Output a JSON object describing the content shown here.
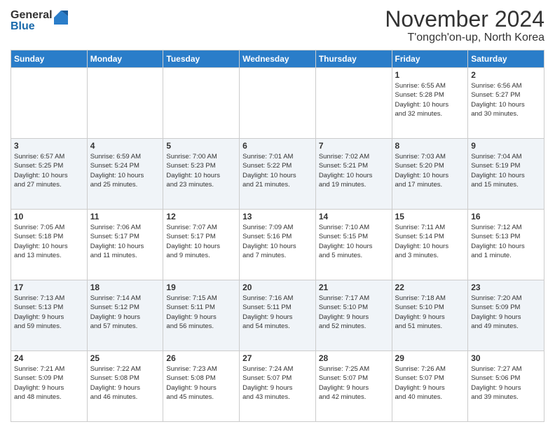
{
  "logo": {
    "general": "General",
    "blue": "Blue"
  },
  "header": {
    "month": "November 2024",
    "location": "T'ongch'on-up, North Korea"
  },
  "days_of_week": [
    "Sunday",
    "Monday",
    "Tuesday",
    "Wednesday",
    "Thursday",
    "Friday",
    "Saturday"
  ],
  "weeks": [
    [
      {
        "day": "",
        "info": ""
      },
      {
        "day": "",
        "info": ""
      },
      {
        "day": "",
        "info": ""
      },
      {
        "day": "",
        "info": ""
      },
      {
        "day": "",
        "info": ""
      },
      {
        "day": "1",
        "info": "Sunrise: 6:55 AM\nSunset: 5:28 PM\nDaylight: 10 hours\nand 32 minutes."
      },
      {
        "day": "2",
        "info": "Sunrise: 6:56 AM\nSunset: 5:27 PM\nDaylight: 10 hours\nand 30 minutes."
      }
    ],
    [
      {
        "day": "3",
        "info": "Sunrise: 6:57 AM\nSunset: 5:25 PM\nDaylight: 10 hours\nand 27 minutes."
      },
      {
        "day": "4",
        "info": "Sunrise: 6:59 AM\nSunset: 5:24 PM\nDaylight: 10 hours\nand 25 minutes."
      },
      {
        "day": "5",
        "info": "Sunrise: 7:00 AM\nSunset: 5:23 PM\nDaylight: 10 hours\nand 23 minutes."
      },
      {
        "day": "6",
        "info": "Sunrise: 7:01 AM\nSunset: 5:22 PM\nDaylight: 10 hours\nand 21 minutes."
      },
      {
        "day": "7",
        "info": "Sunrise: 7:02 AM\nSunset: 5:21 PM\nDaylight: 10 hours\nand 19 minutes."
      },
      {
        "day": "8",
        "info": "Sunrise: 7:03 AM\nSunset: 5:20 PM\nDaylight: 10 hours\nand 17 minutes."
      },
      {
        "day": "9",
        "info": "Sunrise: 7:04 AM\nSunset: 5:19 PM\nDaylight: 10 hours\nand 15 minutes."
      }
    ],
    [
      {
        "day": "10",
        "info": "Sunrise: 7:05 AM\nSunset: 5:18 PM\nDaylight: 10 hours\nand 13 minutes."
      },
      {
        "day": "11",
        "info": "Sunrise: 7:06 AM\nSunset: 5:17 PM\nDaylight: 10 hours\nand 11 minutes."
      },
      {
        "day": "12",
        "info": "Sunrise: 7:07 AM\nSunset: 5:17 PM\nDaylight: 10 hours\nand 9 minutes."
      },
      {
        "day": "13",
        "info": "Sunrise: 7:09 AM\nSunset: 5:16 PM\nDaylight: 10 hours\nand 7 minutes."
      },
      {
        "day": "14",
        "info": "Sunrise: 7:10 AM\nSunset: 5:15 PM\nDaylight: 10 hours\nand 5 minutes."
      },
      {
        "day": "15",
        "info": "Sunrise: 7:11 AM\nSunset: 5:14 PM\nDaylight: 10 hours\nand 3 minutes."
      },
      {
        "day": "16",
        "info": "Sunrise: 7:12 AM\nSunset: 5:13 PM\nDaylight: 10 hours\nand 1 minute."
      }
    ],
    [
      {
        "day": "17",
        "info": "Sunrise: 7:13 AM\nSunset: 5:13 PM\nDaylight: 9 hours\nand 59 minutes."
      },
      {
        "day": "18",
        "info": "Sunrise: 7:14 AM\nSunset: 5:12 PM\nDaylight: 9 hours\nand 57 minutes."
      },
      {
        "day": "19",
        "info": "Sunrise: 7:15 AM\nSunset: 5:11 PM\nDaylight: 9 hours\nand 56 minutes."
      },
      {
        "day": "20",
        "info": "Sunrise: 7:16 AM\nSunset: 5:11 PM\nDaylight: 9 hours\nand 54 minutes."
      },
      {
        "day": "21",
        "info": "Sunrise: 7:17 AM\nSunset: 5:10 PM\nDaylight: 9 hours\nand 52 minutes."
      },
      {
        "day": "22",
        "info": "Sunrise: 7:18 AM\nSunset: 5:10 PM\nDaylight: 9 hours\nand 51 minutes."
      },
      {
        "day": "23",
        "info": "Sunrise: 7:20 AM\nSunset: 5:09 PM\nDaylight: 9 hours\nand 49 minutes."
      }
    ],
    [
      {
        "day": "24",
        "info": "Sunrise: 7:21 AM\nSunset: 5:09 PM\nDaylight: 9 hours\nand 48 minutes."
      },
      {
        "day": "25",
        "info": "Sunrise: 7:22 AM\nSunset: 5:08 PM\nDaylight: 9 hours\nand 46 minutes."
      },
      {
        "day": "26",
        "info": "Sunrise: 7:23 AM\nSunset: 5:08 PM\nDaylight: 9 hours\nand 45 minutes."
      },
      {
        "day": "27",
        "info": "Sunrise: 7:24 AM\nSunset: 5:07 PM\nDaylight: 9 hours\nand 43 minutes."
      },
      {
        "day": "28",
        "info": "Sunrise: 7:25 AM\nSunset: 5:07 PM\nDaylight: 9 hours\nand 42 minutes."
      },
      {
        "day": "29",
        "info": "Sunrise: 7:26 AM\nSunset: 5:07 PM\nDaylight: 9 hours\nand 40 minutes."
      },
      {
        "day": "30",
        "info": "Sunrise: 7:27 AM\nSunset: 5:06 PM\nDaylight: 9 hours\nand 39 minutes."
      }
    ]
  ]
}
